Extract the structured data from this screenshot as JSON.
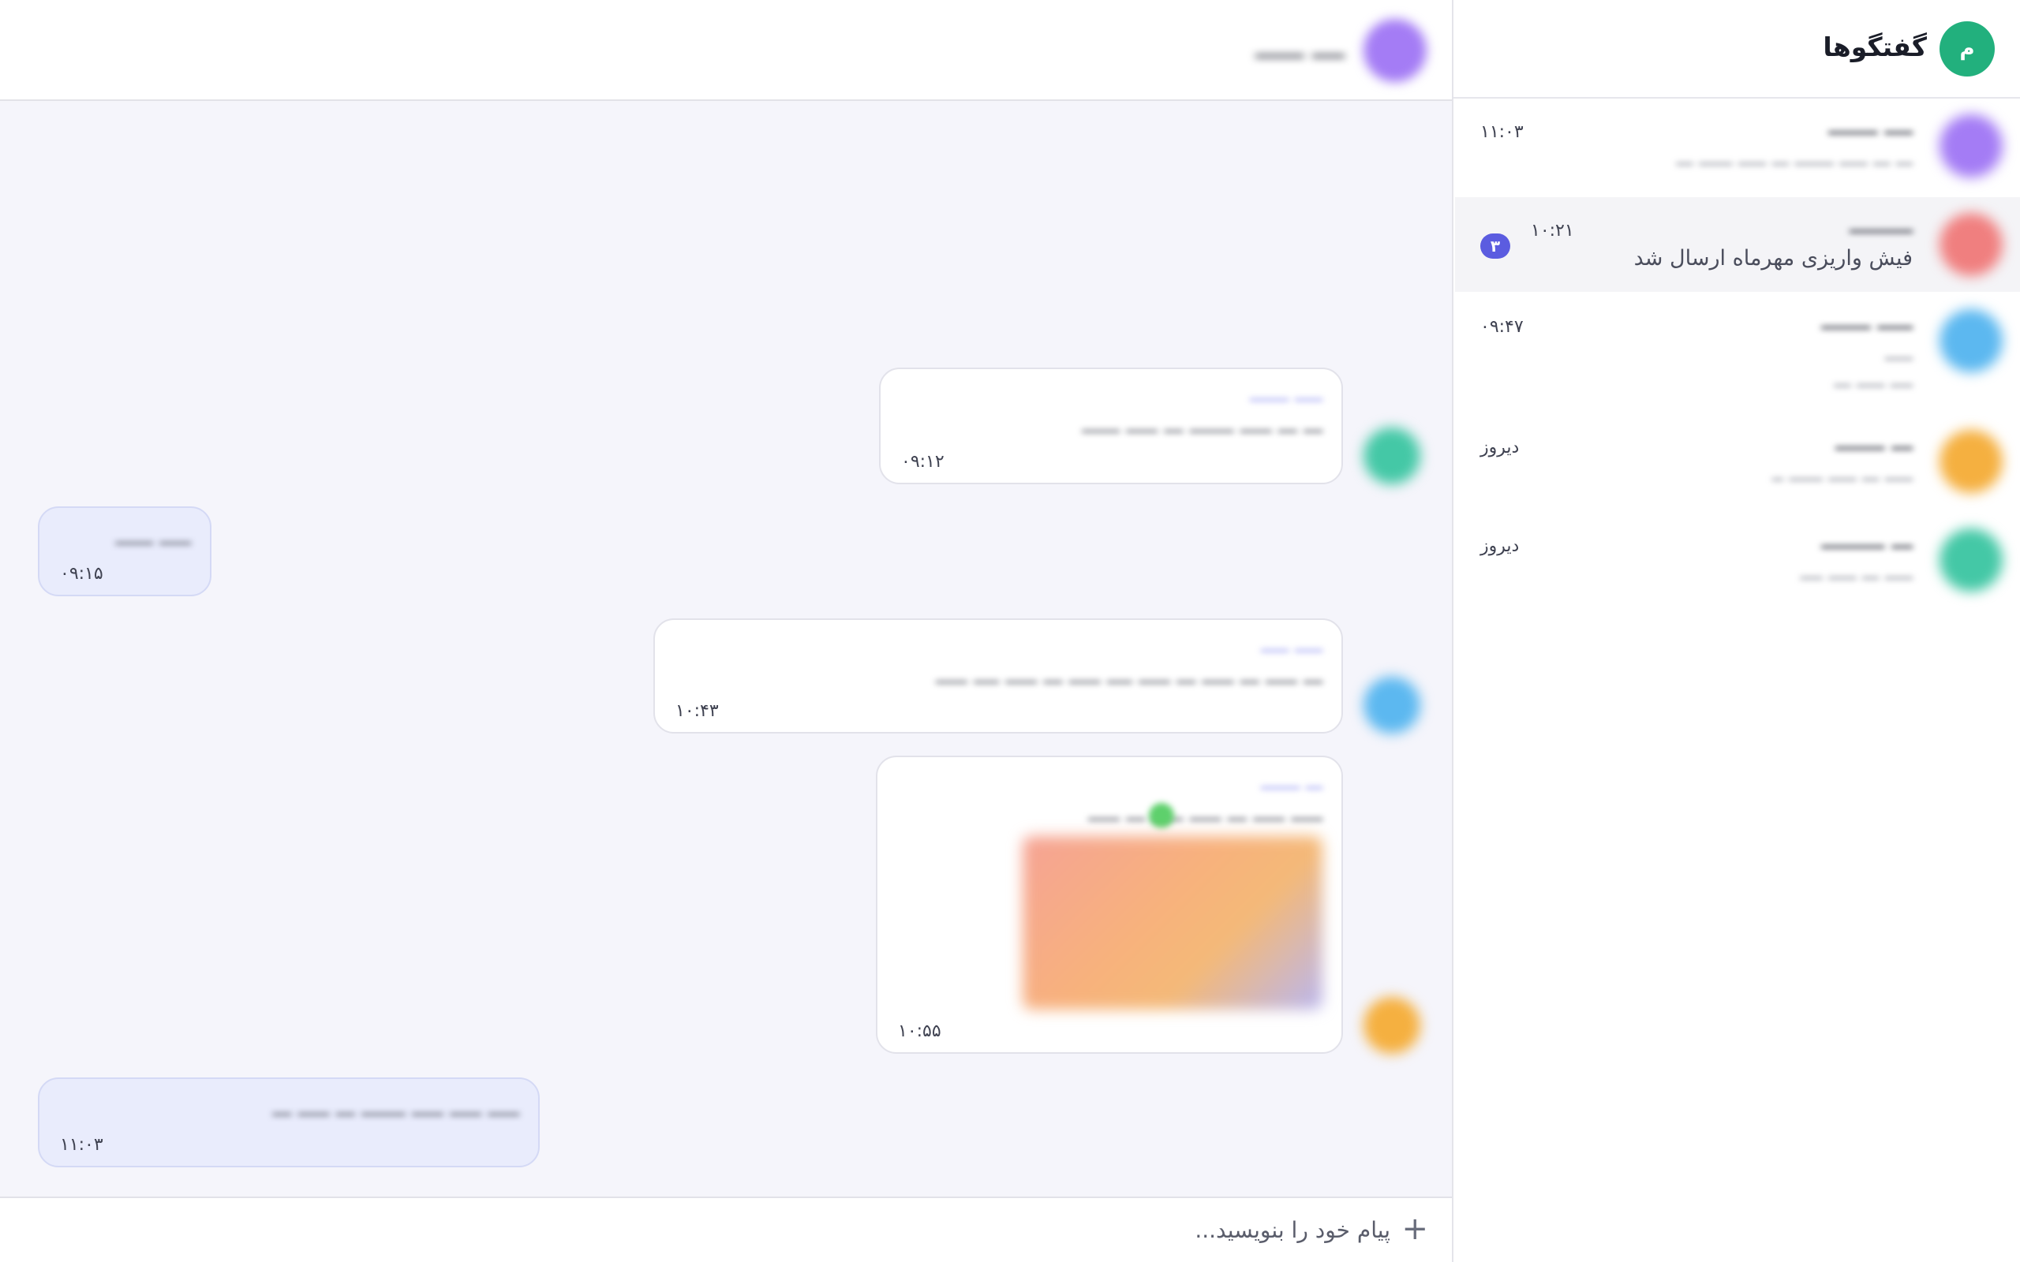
{
  "sidebar": {
    "avatar_initial": "م",
    "title": "گفتگوها",
    "chats": [
      {
        "name": "ــــ ـــــــ",
        "preview": "ـــ ـــ ـــــ ـــــــ ـــ ـــــ ــــــ ـــ",
        "time": "۱۱:۰۳",
        "avatar_color": "#a47cf5",
        "active": false
      },
      {
        "name": "ـــــــــ",
        "preview": "فیش واریزی مهرماه ارسال شد",
        "time": "۱۰:۲۱",
        "badge": "۳",
        "avatar_color": "#f07f7f",
        "active": true
      },
      {
        "name": "ـــــ ـــــــ",
        "preview": "ـــــ",
        "preview_2": "ــــ ـــــ ـــ",
        "time": "۰۹:۴۷",
        "avatar_color": "#5cb8f0",
        "active": false
      },
      {
        "name": "ـــ ـــــــ",
        "preview": "ـــــ ـــ ـــــ ــــــ ــ",
        "time": "دیروز",
        "avatar_color": "#f5b040",
        "active": false
      },
      {
        "name": "ـــ ـــــــــ",
        "preview": "ـــــ ـــ ـــــ ــــ",
        "time": "دیروز",
        "avatar_color": "#44c8a6",
        "active": false
      }
    ]
  },
  "chat": {
    "contact_name": "ــــ ــــــ",
    "contact_color": "#a47cf5",
    "messages": [
      {
        "sender": "ـــــ ـــــــ",
        "text": "ـــ ـــ ـــــ ـــــــ ـــ ـــــ ــــــ",
        "time": "۰۹:۱۲",
        "mine": false,
        "avatar_color": "#44c8a6"
      },
      {
        "text": "ـــــ ــــــ",
        "time": "۰۹:۱۵",
        "mine": true
      },
      {
        "sender": "ـــــ ـــــ",
        "text": "ـــ ـــــ ـــ ـــــ ـــ ـــــ ــــ ـــــ ـــ ـــــ ــــ ـــــ",
        "time": "۱۰:۴۳",
        "mine": false,
        "avatar_color": "#5cb8f0"
      },
      {
        "sender": "ـــ ـــــــ",
        "text": "ـــــ ـــــ ـــ ـــــ ـــــ ـــ ـــــ",
        "time": "۱۰:۵۵",
        "mine": false,
        "avatar_color": "#f5b040",
        "has_image": true
      },
      {
        "text": "ـــــ ـــــ ـــــ ـــــــ ـــ ـــــ ـــ",
        "time": "۱۱:۰۳",
        "mine": true
      }
    ]
  },
  "composer": {
    "placeholder": "پیام خود را بنویسید...",
    "plus": "+"
  }
}
